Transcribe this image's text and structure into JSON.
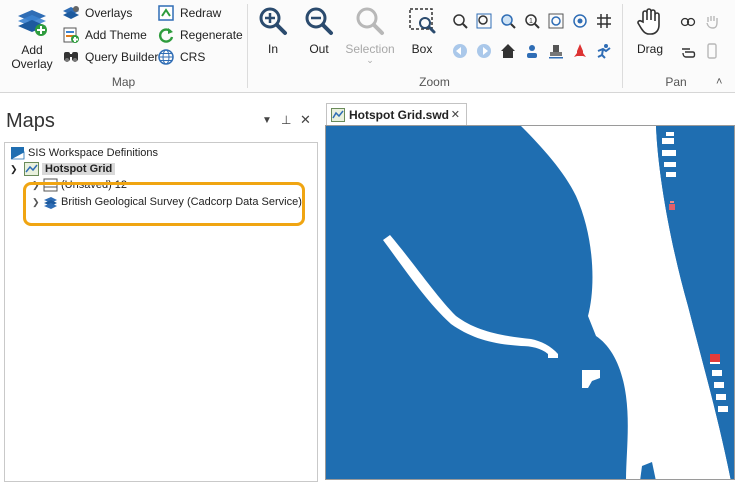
{
  "ribbon": {
    "map_group": {
      "label": "Map",
      "add_overlay": "Add\nOverlay",
      "overlays": "Overlays",
      "add_theme": "Add Theme",
      "query_builder": "Query Builder",
      "redraw": "Redraw",
      "regenerate": "Regenerate",
      "crs": "CRS"
    },
    "zoom_group": {
      "label": "Zoom",
      "in": "In",
      "out": "Out",
      "selection": "Selection",
      "box": "Box"
    },
    "pan_group": {
      "label": "Pan",
      "drag": "Drag"
    }
  },
  "panel": {
    "title": "Maps",
    "tree": {
      "root": "SIS Workspace Definitions",
      "map": "Hotspot Grid",
      "item1": "(Unsaved) 12",
      "item2": "British Geological Survey (Cadcorp Data Service)"
    }
  },
  "document": {
    "tab_label": "Hotspot Grid.swd"
  },
  "colors": {
    "accent": "#1f6eb1",
    "highlight": "#f0a512",
    "water": "#1f6eb1"
  }
}
